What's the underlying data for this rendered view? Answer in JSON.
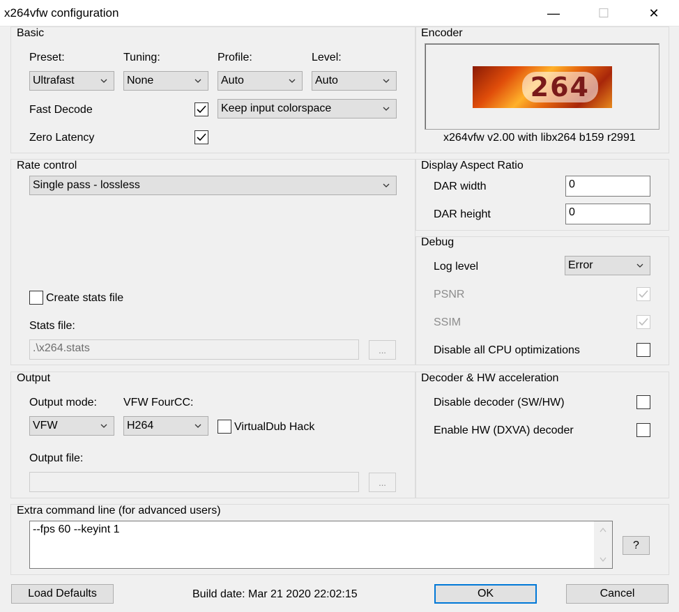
{
  "window": {
    "title": "x264vfw configuration",
    "minimize": "—",
    "maximize": "☐",
    "close": "✕"
  },
  "basic": {
    "group_title": "Basic",
    "preset_label": "Preset:",
    "preset_value": "Ultrafast",
    "tuning_label": "Tuning:",
    "tuning_value": "None",
    "profile_label": "Profile:",
    "profile_value": "Auto",
    "level_label": "Level:",
    "level_value": "Auto",
    "fast_decode_label": "Fast Decode",
    "fast_decode_checked": true,
    "colorspace_value": "Keep input colorspace",
    "zero_latency_label": "Zero Latency",
    "zero_latency_checked": true
  },
  "encoder": {
    "group_title": "Encoder",
    "logo_text": "264",
    "version_text": "x264vfw v2.00  with libx264  b159  r2991"
  },
  "rate_control": {
    "group_title": "Rate control",
    "mode_value": "Single pass - lossless",
    "create_stats_label": "Create stats file",
    "create_stats_checked": false,
    "stats_file_label": "Stats file:",
    "stats_file_value": ".\\x264.stats",
    "browse_label": "..."
  },
  "dar": {
    "group_title": "Display Aspect Ratio",
    "width_label": "DAR width",
    "width_value": "0",
    "height_label": "DAR height",
    "height_value": "0"
  },
  "debug": {
    "group_title": "Debug",
    "log_level_label": "Log level",
    "log_level_value": "Error",
    "psnr_label": "PSNR",
    "psnr_checked": true,
    "ssim_label": "SSIM",
    "ssim_checked": true,
    "disable_cpu_label": "Disable all CPU optimizations",
    "disable_cpu_checked": false
  },
  "output": {
    "group_title": "Output",
    "mode_label": "Output mode:",
    "mode_value": "VFW",
    "fourcc_label": "VFW FourCC:",
    "fourcc_value": "H264",
    "vdub_hack_label": "VirtualDub Hack",
    "vdub_hack_checked": false,
    "file_label": "Output file:",
    "file_value": "",
    "browse_label": "..."
  },
  "decoder": {
    "group_title": "Decoder & HW acceleration",
    "disable_decoder_label": "Disable decoder (SW/HW)",
    "disable_decoder_checked": false,
    "enable_hw_label": "Enable HW (DXVA) decoder",
    "enable_hw_checked": false
  },
  "extra": {
    "group_title": "Extra command line (for advanced users)",
    "value": "--fps 60 --keyint 1",
    "help_label": "?"
  },
  "footer": {
    "load_defaults_label": "Load Defaults",
    "build_date": "Build date: Mar 21 2020 22:02:15",
    "ok_label": "OK",
    "cancel_label": "Cancel"
  },
  "colors": {
    "accent": "#0078d7",
    "dialog_bg": "#f0f0f0",
    "group_border": "#dcdcdc"
  }
}
